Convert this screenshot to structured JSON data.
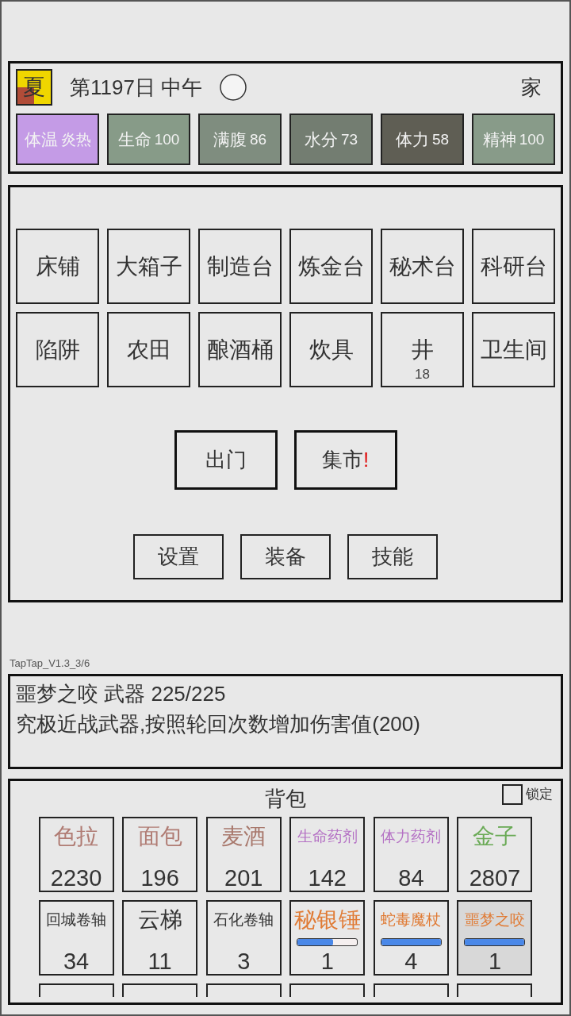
{
  "status": {
    "season": {
      "label": "夏",
      "level": 0.5
    },
    "day": "第1197日 中午",
    "location": "家",
    "stats": [
      {
        "label": "体温",
        "value": "炎热",
        "color": "#c49be6"
      },
      {
        "label": "生命",
        "value": "100",
        "color": "#879b88"
      },
      {
        "label": "满腹",
        "value": "86",
        "color": "#7f8d7f"
      },
      {
        "label": "水分",
        "value": "73",
        "color": "#737d71"
      },
      {
        "label": "体力",
        "value": "58",
        "color": "#5f5e54"
      },
      {
        "label": "精神",
        "value": "100",
        "color": "#889b89"
      }
    ]
  },
  "facilities": [
    {
      "label": "床铺"
    },
    {
      "label": "大箱子"
    },
    {
      "label": "制造台"
    },
    {
      "label": "炼金台"
    },
    {
      "label": "秘术台"
    },
    {
      "label": "科研台"
    },
    {
      "label": "陷阱"
    },
    {
      "label": "农田"
    },
    {
      "label": "酿酒桶"
    },
    {
      "label": "炊具"
    },
    {
      "label": "井",
      "count": "18"
    },
    {
      "label": "卫生间"
    }
  ],
  "actions": [
    {
      "label": "出门"
    },
    {
      "label": "集市",
      "alert": "!"
    }
  ],
  "menu": [
    {
      "label": "设置"
    },
    {
      "label": "装备"
    },
    {
      "label": "技能"
    }
  ],
  "version": "TapTap_V1.3_3/6",
  "description": {
    "title": "噩梦之咬 武器 225/225",
    "text": "究极近战武器,按照轮回次数增加伤害值(200)"
  },
  "inventory": {
    "title": "背包",
    "lock": {
      "label": "锁定",
      "checked": false
    },
    "items": [
      {
        "kind": "stack",
        "name": "色拉",
        "count": "2230",
        "color": "#b07c74",
        "selected": false
      },
      {
        "kind": "stack",
        "name": "面包",
        "count": "196",
        "color": "#b07c74",
        "selected": false
      },
      {
        "kind": "stack",
        "name": "麦酒",
        "count": "201",
        "color": "#a8786c",
        "selected": false
      },
      {
        "kind": "stack",
        "name": "生命药剂",
        "count": "142",
        "color": "#b470c4",
        "selected": false
      },
      {
        "kind": "stack",
        "name": "体力药剂",
        "count": "84",
        "color": "#b470c4",
        "selected": false
      },
      {
        "kind": "stack",
        "name": "金子",
        "count": "2807",
        "color": "#6aaa56",
        "selected": false
      },
      {
        "kind": "stack",
        "name": "回城卷轴",
        "count": "34",
        "color": "#333333",
        "selected": false
      },
      {
        "kind": "stack",
        "name": "云梯",
        "count": "11",
        "color": "#333333",
        "selected": false
      },
      {
        "kind": "stack",
        "name": "石化卷轴",
        "count": "3",
        "color": "#333333",
        "selected": false
      },
      {
        "kind": "tool",
        "name": "秘银锤",
        "count": "1",
        "color": "#e07b35",
        "level": 0.6,
        "selected": false
      },
      {
        "kind": "tool",
        "name": "蛇毒魔杖",
        "count": "4",
        "color": "#e07b35",
        "level": 1,
        "selected": false
      },
      {
        "kind": "tool",
        "name": "噩梦之咬",
        "count": "1",
        "color": "#e07b35",
        "level": 1,
        "selected": true
      },
      {
        "kind": "slot",
        "selected": false
      },
      {
        "kind": "slot",
        "selected": false
      },
      {
        "kind": "slot",
        "selected": false
      },
      {
        "kind": "slot",
        "selected": false
      },
      {
        "kind": "slot",
        "selected": false
      },
      {
        "kind": "slot",
        "selected": false
      }
    ]
  }
}
